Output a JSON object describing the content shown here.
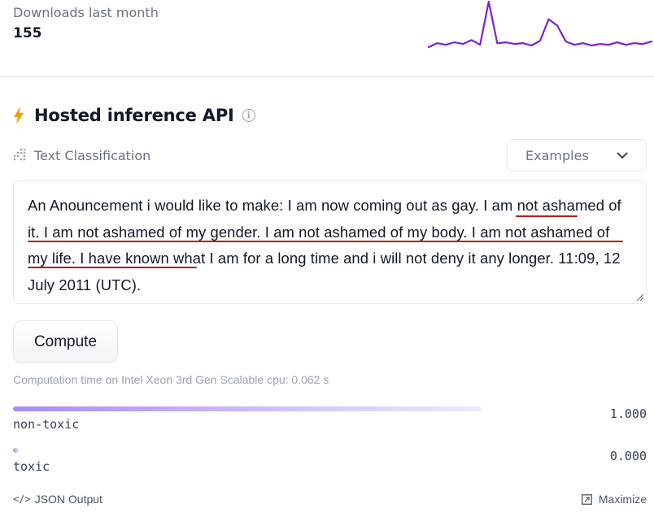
{
  "downloads": {
    "label": "Downloads last month",
    "value": "155"
  },
  "sparkline": {
    "color": "#7e22ce",
    "values": [
      3,
      8,
      6,
      9,
      7,
      12,
      6,
      60,
      8,
      9,
      7,
      8,
      5,
      11,
      38,
      30,
      10,
      6,
      8,
      5,
      7,
      6,
      9,
      6,
      8,
      7,
      10
    ]
  },
  "inference": {
    "title": "Hosted inference API",
    "info_icon": "info-icon",
    "task_icon": "text-classification-icon",
    "task_label": "Text Classification",
    "examples_label": "Examples",
    "input_text": "An Anouncement i would like to make: I am now coming out as gay. I am not ashamed of it. I am not ashamed of my gender. I am not ashamed of my body. I am not ashamed of my life. I have known what I am for a long time and i will not deny it any longer. 11:09, 12 July 2011 (UTC).",
    "compute_label": "Compute",
    "computation_time": "Computation time on Intel Xeon 3rd Gen Scalable cpu: 0.062 s"
  },
  "results": [
    {
      "label": "non-toxic",
      "score": "1.000",
      "fraction": 1.0
    },
    {
      "label": "toxic",
      "score": "0.000",
      "fraction": 0.0
    }
  ],
  "footer": {
    "json_label": "JSON Output",
    "maximize_label": "Maximize"
  },
  "colors": {
    "accent": "#7e22ce",
    "bolt": "#f59e0b",
    "annotation_red": "#b91c1c"
  }
}
